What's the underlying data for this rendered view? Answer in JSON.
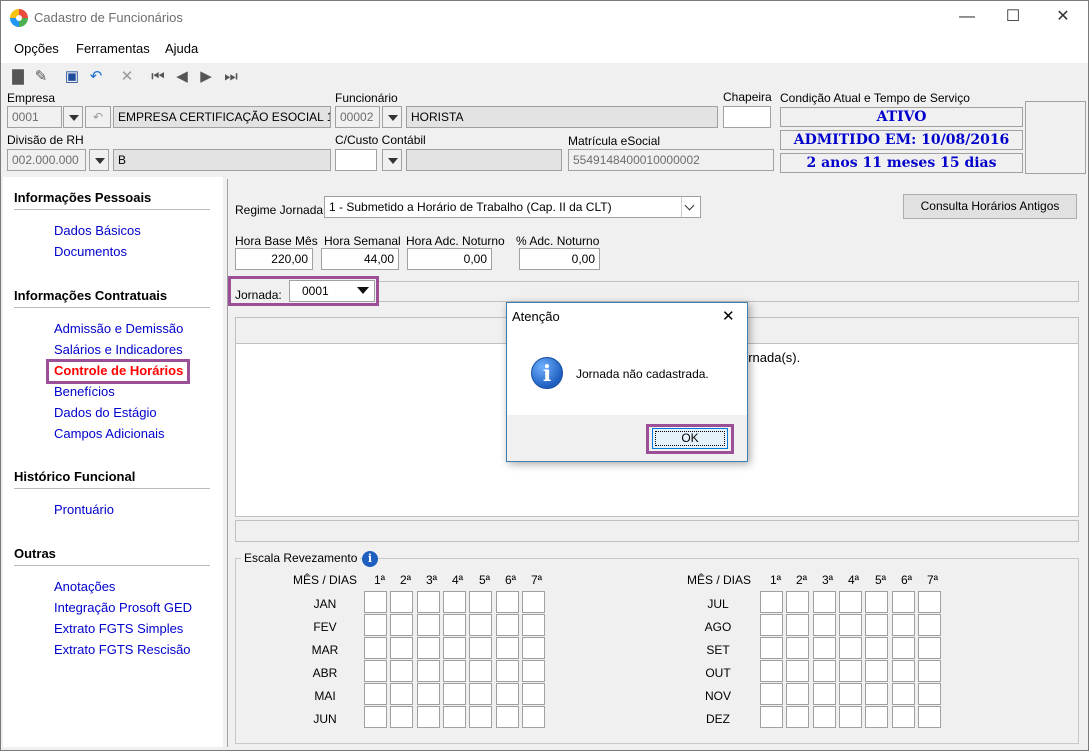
{
  "window": {
    "title": "Cadastro de Funcionários",
    "minimize": "—",
    "maximize": "☐",
    "close": "✕"
  },
  "menu": [
    "Opções",
    "Ferramentas",
    "Ajuda"
  ],
  "header": {
    "empresa_label": "Empresa",
    "empresa_code": "0001",
    "empresa_name": "EMPRESA CERTIFICAÇÃO ESOCIAL 1",
    "funcionario_label": "Funcionário",
    "funcionario_code": "00002",
    "funcionario_name": "HORISTA",
    "chapeira_label": "Chapeira",
    "chapeira_value": "",
    "divisao_label": "Divisão de RH",
    "divisao_code": "002.000.000",
    "divisao_name": "B",
    "custo_label": "C/Custo Contábil",
    "custo_code": "",
    "custo_name": "",
    "matricula_label": "Matrícula eSocial",
    "matricula_value": "5549148400010000002",
    "condicao_label": "Condição Atual e Tempo de Serviço",
    "status": "ATIVO",
    "admitido": "ADMITIDO EM: 10/08/2016",
    "tempo": "2 anos 11 meses 15 dias"
  },
  "sidebar": {
    "sections": [
      {
        "title": "Informações Pessoais",
        "items": [
          "Dados Básicos",
          "Documentos"
        ]
      },
      {
        "title": "Informações Contratuais",
        "items": [
          "Admissão e Demissão",
          "Salários e Indicadores",
          "Controle de Horários",
          "Benefícios",
          "Dados do Estágio",
          "Campos Adicionais"
        ]
      },
      {
        "title": "Histórico Funcional",
        "items": [
          "Prontuário"
        ]
      },
      {
        "title": "Outras",
        "items": [
          "Anotações",
          "Integração Prosoft GED",
          "Extrato FGTS Simples",
          "Extrato FGTS Rescisão"
        ]
      }
    ]
  },
  "main": {
    "regime_label": "Regime Jornada",
    "regime_value": "1 - Submetido a Horário de Trabalho (Cap. II da CLT)",
    "consulta_button": "Consulta Horários Antigos",
    "hora_base_label": "Hora Base Mês",
    "hora_base_value": "220,00",
    "hora_semanal_label": "Hora Semanal",
    "hora_semanal_value": "44,00",
    "hora_adc_label": "Hora Adc. Noturno",
    "hora_adc_value": "0,00",
    "pct_adc_label": "% Adc. Noturno",
    "pct_adc_value": "0,00",
    "jornada_label": "Jornada:",
    "jornada_value": "0001",
    "panel_text": "ornada(s).",
    "escala_label": "Escala Revezamento",
    "mes_dias_label": "MÊS / DIAS",
    "weeks": [
      "1ª",
      "2ª",
      "3ª",
      "4ª",
      "5ª",
      "6ª",
      "7ª"
    ],
    "months_left": [
      "JAN",
      "FEV",
      "MAR",
      "ABR",
      "MAI",
      "JUN"
    ],
    "months_right": [
      "JUL",
      "AGO",
      "SET",
      "OUT",
      "NOV",
      "DEZ"
    ]
  },
  "dialog": {
    "title": "Atenção",
    "close": "✕",
    "message": "Jornada não cadastrada.",
    "ok": "OK",
    "icon": "i"
  },
  "colors": {
    "highlight": "#9b4f96",
    "link": "#0000cc",
    "active_link": "#ff0000",
    "status_text": "#0000cc"
  }
}
